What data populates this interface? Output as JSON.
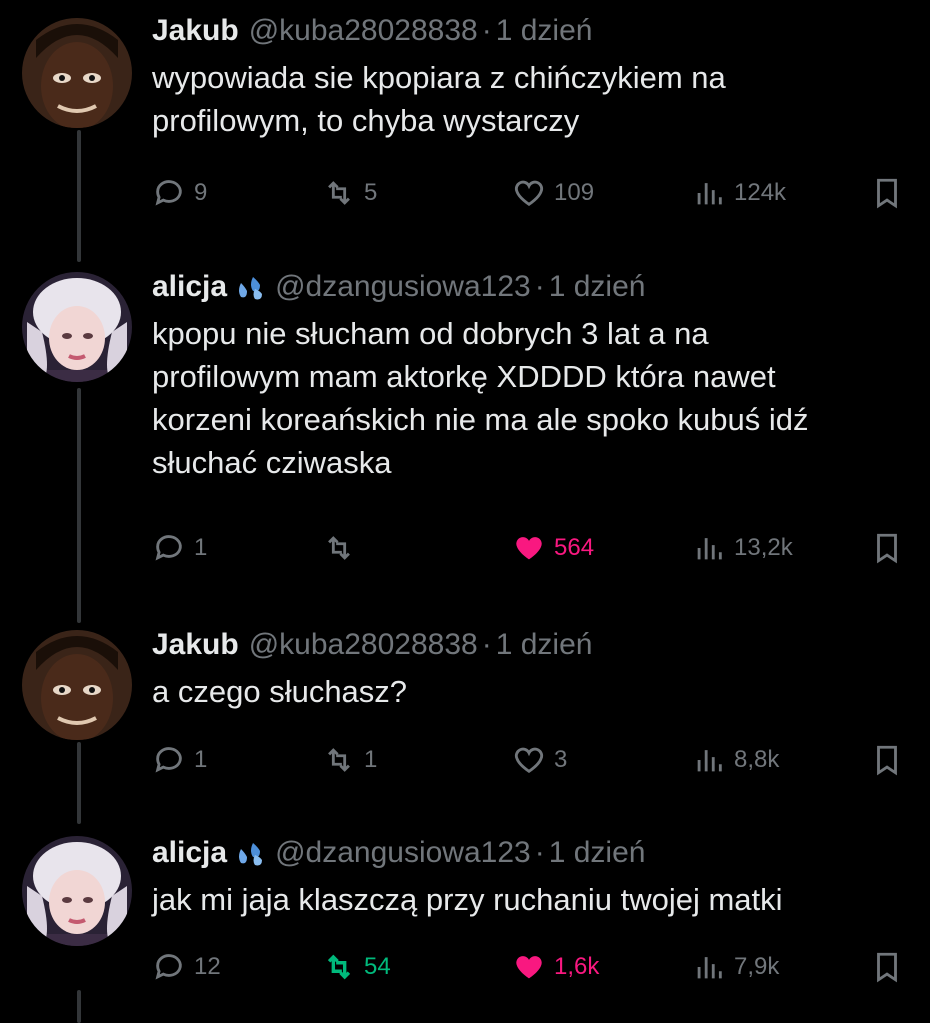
{
  "colors": {
    "background": "#000000",
    "text": "#e7e9ea",
    "muted": "#71767b",
    "like": "#f91880",
    "retweet": "#00ba7c",
    "thread_line": "#333639"
  },
  "tweets": [
    {
      "name": "Jakub",
      "handle": "@kuba28028838",
      "sep": "·",
      "time": "1 dzień",
      "text": "wypowiada sie kpopiara z chińczykiem na\nprofilowym, to chyba wystarczy",
      "replies": "9",
      "retweets": "5",
      "likes": "109",
      "views": "124k",
      "liked": false,
      "retweeted": false,
      "avatar_icon": "avatar-man"
    },
    {
      "name": "alicja",
      "handle": "@dzangusiowa123",
      "sep": "·",
      "time": "1 dzień",
      "text": "kpopu nie słucham od dobrych 3 lat a na\nprofilowym mam aktorkę XDDDD która nawet\nkorzeni koreańskich nie ma ale spoko kubuś idź\nsłuchać cziwaska",
      "replies": "1",
      "retweets": "",
      "likes": "564",
      "views": "13,2k",
      "liked": true,
      "retweeted": false,
      "emoji_icon": "droplets-emoji",
      "avatar_icon": "avatar-woman"
    },
    {
      "name": "Jakub",
      "handle": "@kuba28028838",
      "sep": "·",
      "time": "1 dzień",
      "text": "a czego słuchasz?",
      "replies": "1",
      "retweets": "1",
      "likes": "3",
      "views": "8,8k",
      "liked": false,
      "retweeted": false,
      "avatar_icon": "avatar-man"
    },
    {
      "name": "alicja",
      "handle": "@dzangusiowa123",
      "sep": "·",
      "time": "1 dzień",
      "text": "jak mi jaja klaszczą przy ruchaniu twojej matki",
      "replies": "12",
      "retweets": "54",
      "likes": "1,6k",
      "views": "7,9k",
      "liked": true,
      "retweeted": true,
      "emoji_icon": "droplets-emoji",
      "avatar_icon": "avatar-woman"
    }
  ]
}
